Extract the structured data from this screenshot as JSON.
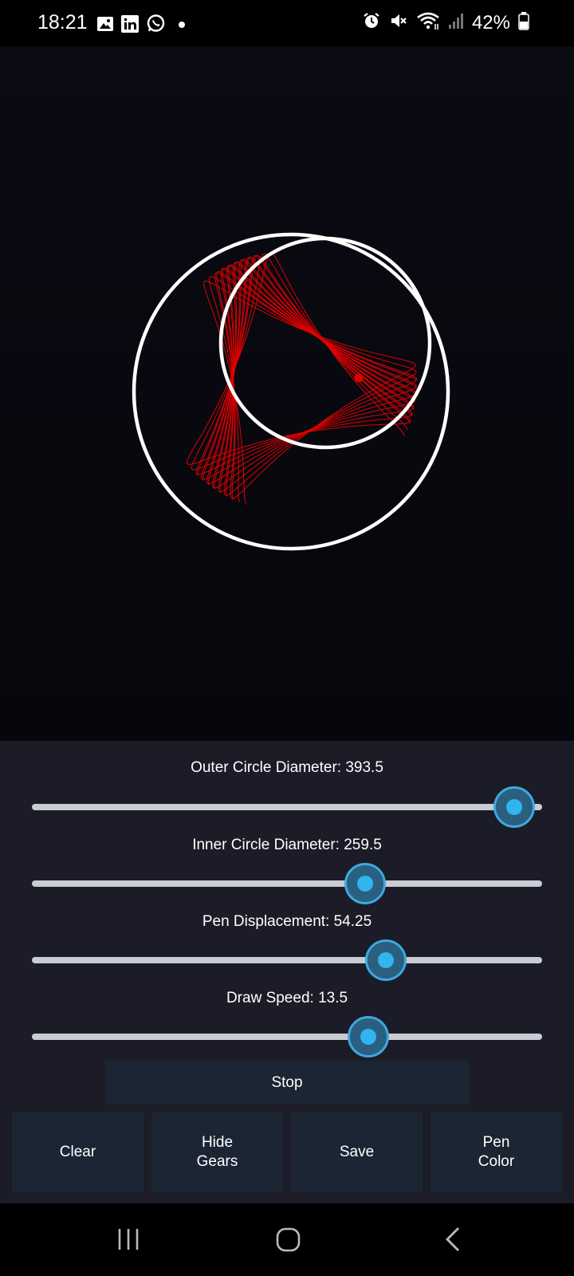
{
  "status_bar": {
    "time": "18:21",
    "left_icons": [
      "gallery-icon",
      "linkedin-icon",
      "whatsapp-icon",
      "dot-icon"
    ],
    "right_icons": [
      "alarm-icon",
      "mute-icon",
      "wifi-icon",
      "signal-icon",
      "battery-icon"
    ],
    "battery": "42%"
  },
  "canvas": {
    "gear_color": "#ffffff",
    "pen_color": "#e00000",
    "background": "#07080d"
  },
  "sliders": [
    {
      "key": "outer",
      "label": "Outer Circle Diameter: 393.5",
      "fraction": 0.945
    },
    {
      "key": "inner",
      "label": "Inner Circle Diameter: 259.5",
      "fraction": 0.653
    },
    {
      "key": "pen",
      "label": "Pen Displacement: 54.25",
      "fraction": 0.694
    },
    {
      "key": "speed",
      "label": "Draw Speed: 13.5",
      "fraction": 0.659
    }
  ],
  "buttons": {
    "stop": "Stop",
    "clear": "Clear",
    "hide_gears": "Hide\nGears",
    "save": "Save",
    "pen_color": "Pen\nColor"
  },
  "colors": {
    "accent": "#31b4ef",
    "panel": "#1b1c27",
    "button": "#1b2533"
  },
  "nav": [
    "recents-icon",
    "home-icon",
    "back-icon"
  ]
}
